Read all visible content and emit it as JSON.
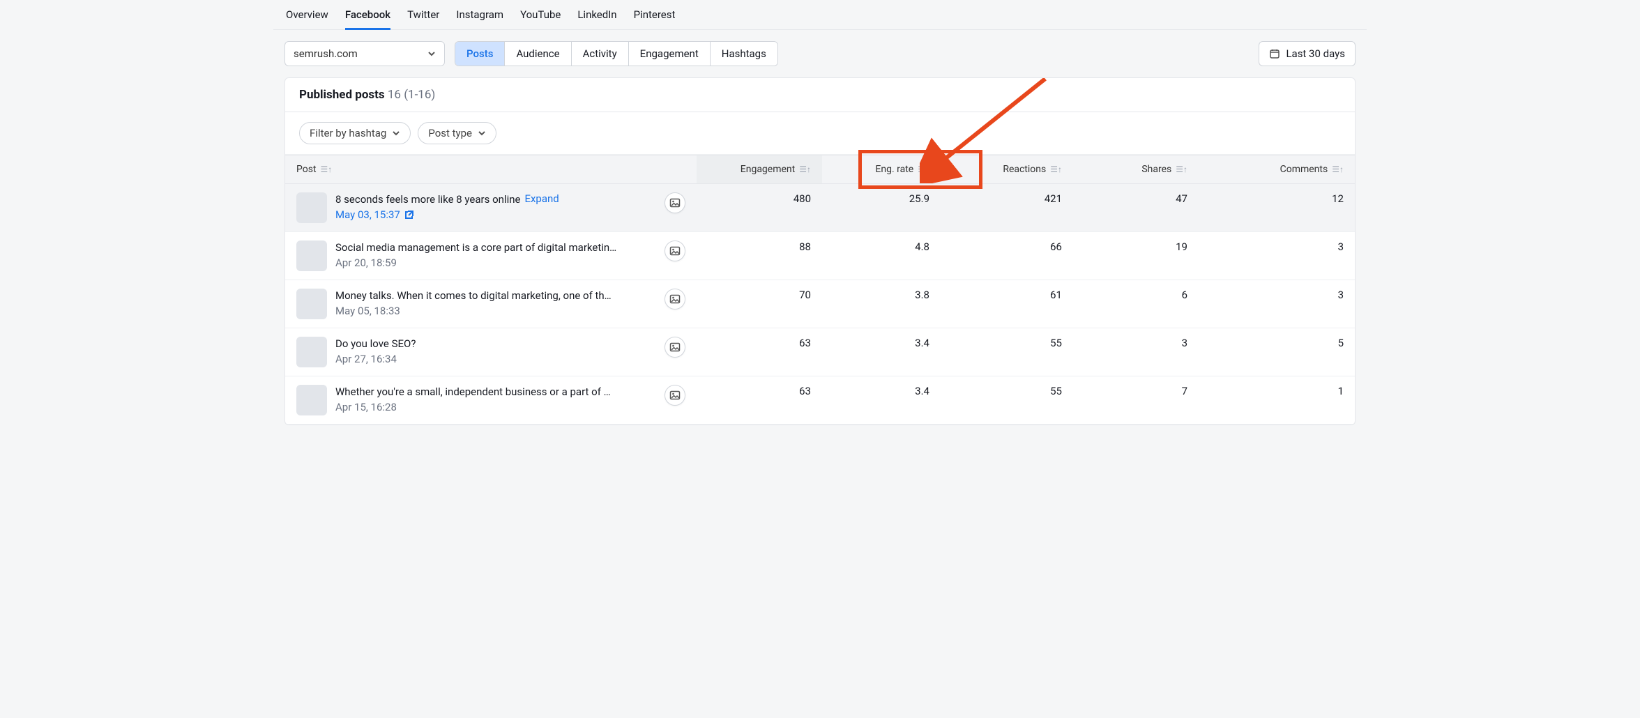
{
  "nav_tabs": [
    "Overview",
    "Facebook",
    "Twitter",
    "Instagram",
    "YouTube",
    "LinkedIn",
    "Pinterest"
  ],
  "nav_active_index": 1,
  "domain_selector": {
    "value": "semrush.com"
  },
  "segments": [
    "Posts",
    "Audience",
    "Activity",
    "Engagement",
    "Hashtags"
  ],
  "segment_active_index": 0,
  "date_button": {
    "label": "Last 30 days"
  },
  "panel_title": "Published posts",
  "panel_count_suffix": "16 (1-16)",
  "filters": {
    "hashtag_label": "Filter by hashtag",
    "posttype_label": "Post type"
  },
  "columns": {
    "post": "Post",
    "engagement": "Engagement",
    "eng_rate": "Eng. rate",
    "reactions": "Reactions",
    "shares": "Shares",
    "comments": "Comments"
  },
  "expand_label": "Expand",
  "rows": [
    {
      "title": "8 seconds feels more like 8 years online",
      "date": "May 03, 15:37",
      "linked_date": true,
      "expanded": true,
      "engagement": "480",
      "eng_rate": "25.9",
      "reactions": "421",
      "shares": "47",
      "comments": "12"
    },
    {
      "title": "Social media management is a core part of digital marketin…",
      "date": "Apr 20, 18:59",
      "engagement": "88",
      "eng_rate": "4.8",
      "reactions": "66",
      "shares": "19",
      "comments": "3"
    },
    {
      "title": "Money talks. When it comes to digital marketing, one of th…",
      "date": "May 05, 18:33",
      "engagement": "70",
      "eng_rate": "3.8",
      "reactions": "61",
      "shares": "6",
      "comments": "3"
    },
    {
      "title": "Do you love SEO?",
      "date": "Apr 27, 16:34",
      "engagement": "63",
      "eng_rate": "3.4",
      "reactions": "55",
      "shares": "3",
      "comments": "5"
    },
    {
      "title": "Whether you're a small, independent business or a part of …",
      "date": "Apr 15, 16:28",
      "engagement": "63",
      "eng_rate": "3.4",
      "reactions": "55",
      "shares": "7",
      "comments": "1"
    }
  ]
}
